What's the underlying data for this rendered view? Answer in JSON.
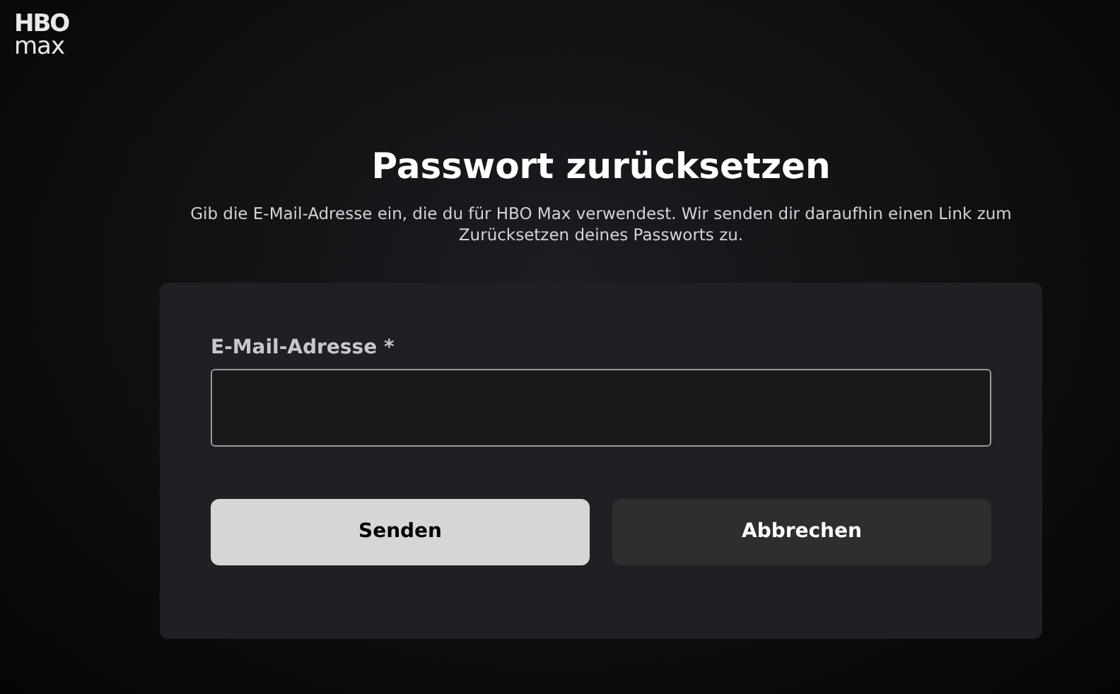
{
  "logo": {
    "line_1": "HBO",
    "line_2": "max"
  },
  "title": "Passwort zurücksetzen",
  "description": "Gib die E-Mail-Adresse ein, die du für HBO Max verwendest. Wir senden dir daraufhin einen Link zum Zurücksetzen deines Passworts zu.",
  "form": {
    "email_field": {
      "label": "E-Mail-Adresse *"
    },
    "buttons": [
      {
        "label": "Senden",
        "kind": "primary"
      },
      {
        "label": "Abbrechen",
        "kind": "secondary"
      }
    ]
  }
}
